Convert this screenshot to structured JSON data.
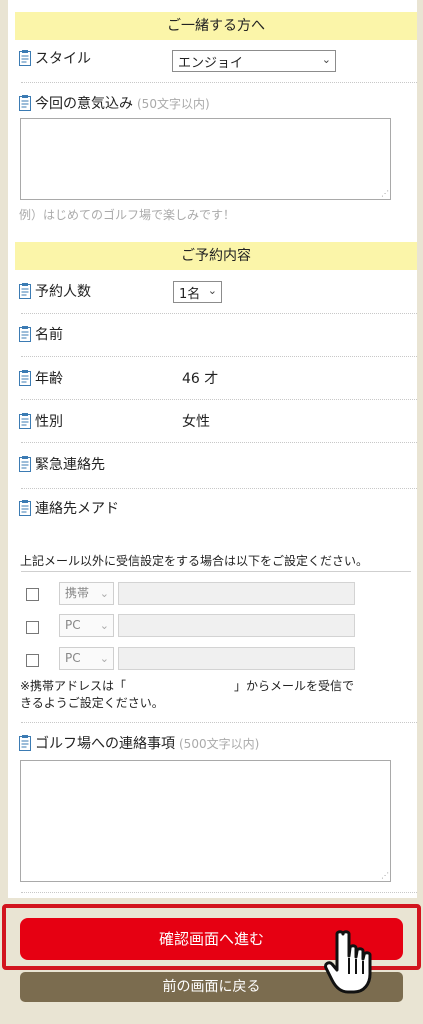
{
  "companion_section": {
    "header": "ご一緒する方へ",
    "style_label": "スタイル",
    "style_value": "エンジョイ",
    "motivation_label": "今回の意気込み",
    "motivation_hint": "(50文字以内)",
    "motivation_example": "例）はじめてのゴルフ場で楽しみです！"
  },
  "reservation_section": {
    "header": "ご予約内容",
    "party_size_label": "予約人数",
    "party_size_value": "1名",
    "name_label": "名前",
    "age_label": "年齢",
    "age_value": "46 才",
    "gender_label": "性別",
    "gender_value": "女性",
    "emergency_label": "緊急連絡先",
    "email_label": "連絡先メアド",
    "mail_settings_note": "上記メール以外に受信設定をする場合は以下をご設定ください。",
    "mail_rows": [
      {
        "type": "携帯"
      },
      {
        "type": "PC"
      },
      {
        "type": "PC"
      }
    ],
    "mobile_note_line1": "※携帯アドレスは「　　　　　　　　　」からメールを受信で",
    "mobile_note_line2": "きるようご設定ください。",
    "golf_message_label": "ゴルフ場への連絡事項",
    "golf_message_hint": "(500文字以内)"
  },
  "buttons": {
    "confirm": "確認画面へ進む",
    "back": "前の画面に戻る"
  },
  "colors": {
    "section_header_bg": "#fbf5a9",
    "confirm_button": "#e60012",
    "back_button": "#7b6c4f",
    "page_bg": "#e9e4d3"
  }
}
